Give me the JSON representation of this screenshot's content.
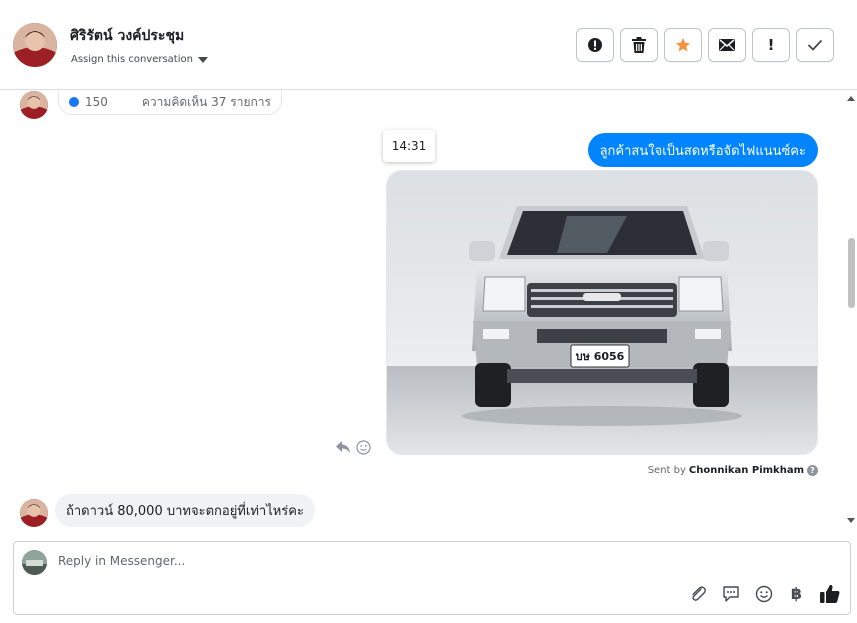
{
  "header": {
    "contact_name": "ศิริรัตน์ วงค์ประชุม",
    "assign_label": "Assign this conversation",
    "actions": [
      {
        "name": "alert-icon"
      },
      {
        "name": "trash-icon"
      },
      {
        "name": "star-icon"
      },
      {
        "name": "mail-icon"
      },
      {
        "name": "exclamation-icon",
        "text": "!"
      },
      {
        "name": "check-icon"
      }
    ]
  },
  "conversation": {
    "previous_post": {
      "likes": "150",
      "comments": "ความคิดเห็น 37 รายการ"
    },
    "time_chip": "14:31",
    "outgoing_text": "ลูกค้าสนใจเป็นสดหรือจัดไฟแนนซ์คะ",
    "photo": {
      "plate_text": "บษ 6056"
    },
    "sent_by_prefix": "Sent by",
    "sent_by_name": "Chonnikan Pimkham",
    "incoming_text": "ถ้าดาวน์ 80,000 บาทจะตกอยู่ที่เท่าไหร่คะ"
  },
  "composer": {
    "placeholder": "Reply in Messenger...",
    "tools": [
      "paperclip-icon",
      "chat-icon",
      "smiley-icon",
      "baht-icon",
      "thumbs-up-icon"
    ],
    "baht_symbol": "฿"
  },
  "colors": {
    "accent": "#0084ff",
    "star": "#f7923b",
    "bubble_incoming": "#f0f2f5"
  }
}
